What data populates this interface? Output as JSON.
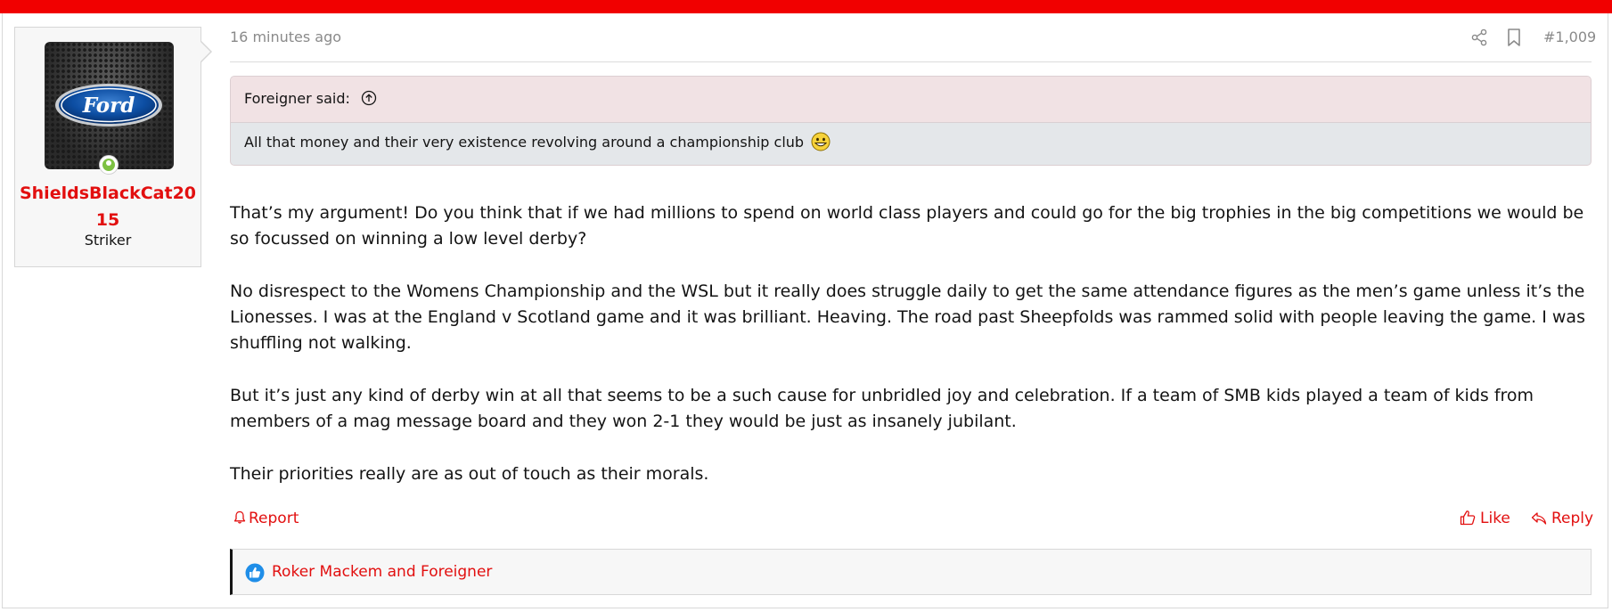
{
  "colors": {
    "accent": "#e20f0f",
    "top_bar": "#f10000",
    "online": "#7dc142",
    "like_badge": "#1f8ee8"
  },
  "user": {
    "avatar_text": "Ford",
    "username": "ShieldsBlackCat2015",
    "title": "Striker"
  },
  "post": {
    "time": "16 minutes ago",
    "number": "#1,009",
    "icons": [
      "share-icon",
      "bookmark-icon"
    ]
  },
  "quote": {
    "author": "Foreigner said:",
    "text": "All that money and their very existence revolving around a championship club"
  },
  "body": {
    "paragraphs": [
      "That’s my argument! Do you think that if we had millions to spend on world class players and could go for the big trophies in the big competitions we would be so focussed on winning a low level derby?",
      "No disrespect to the Womens Championship and the WSL but it really does struggle daily to get the same attendance figures as the men’s game unless it’s the Lionesses. I was at the England v Scotland game and it was brilliant. Heaving. The road past Sheepfolds was rammed solid with people leaving the game. I was shuffling not walking.",
      "But it’s just any kind of derby win at all that seems to be a such cause for unbridled joy and celebration. If a team of SMB kids played a team of kids from members of a mag message board and they won 2-1 they would be just as insanely jubilant.",
      "Their priorities really are as out of touch as their morals."
    ]
  },
  "actions": {
    "report": "Report",
    "like": "Like",
    "reply": "Reply"
  },
  "reactions": {
    "text": "Roker Mackem and Foreigner"
  }
}
